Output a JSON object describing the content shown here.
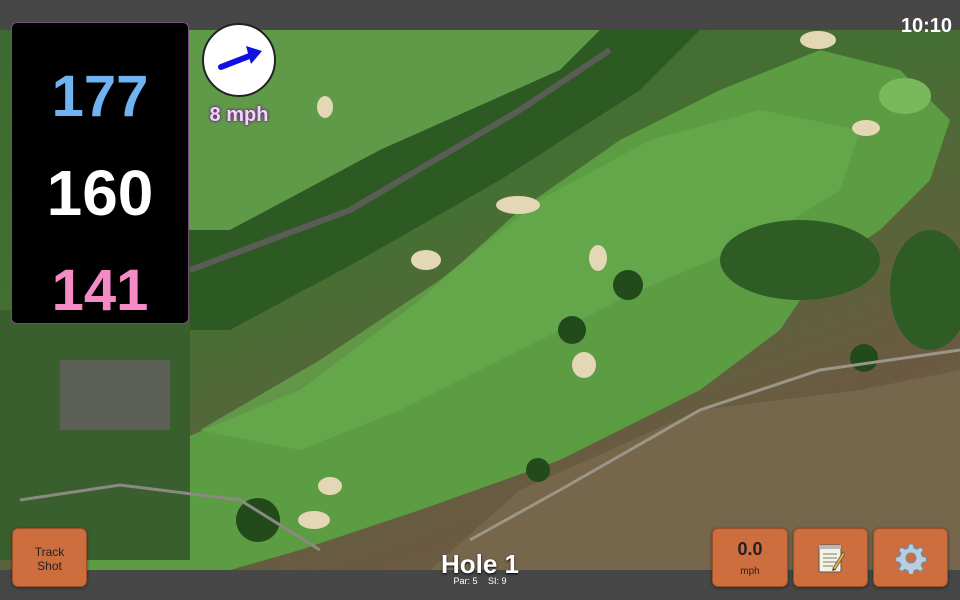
{
  "status": {
    "time": "10:10"
  },
  "distances": {
    "back": "177",
    "middle": "160",
    "front": "141"
  },
  "wind": {
    "speed_label": "8 mph",
    "direction_icon": "arrow-icon"
  },
  "hole": {
    "title": "Hole 1",
    "par_label": "Par: 5",
    "si_label": "SI: 9"
  },
  "buttons": {
    "track_line1": "Track",
    "track_line2": "Shot",
    "speed_value": "0.0",
    "speed_unit": "mph",
    "notes_icon": "notepad-icon",
    "settings_icon": "gear-icon"
  },
  "colors": {
    "back_distance": "#6fb3f2",
    "middle_distance": "#ffffff",
    "front_distance": "#f48bc7",
    "button": "#cd6e3e"
  }
}
